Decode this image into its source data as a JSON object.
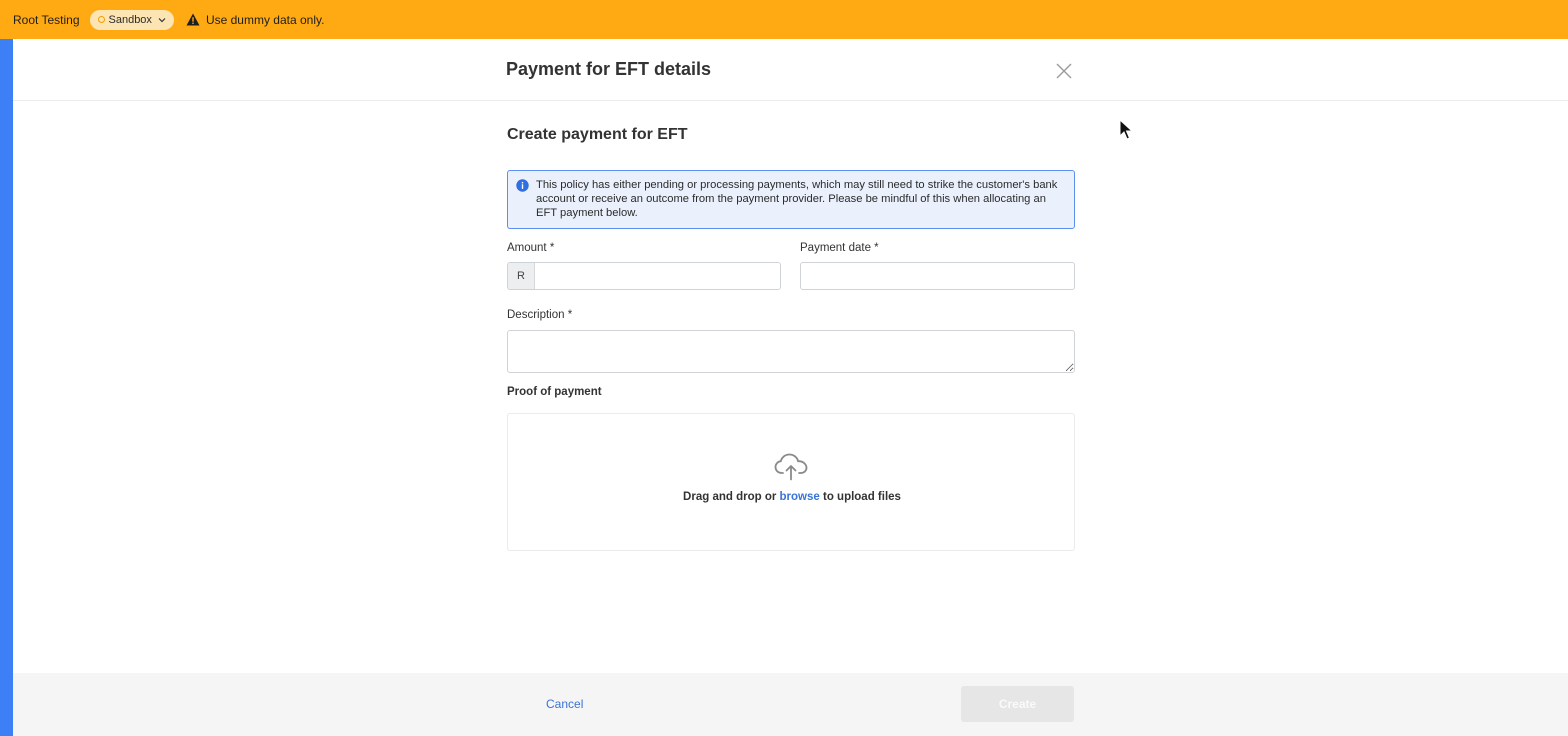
{
  "banner": {
    "org_name": "Root Testing",
    "environment": "Sandbox",
    "warning": "Use dummy data only.",
    "background_color": "#ffaa12"
  },
  "modal": {
    "title": "Payment for EFT details",
    "close_icon": "close-icon"
  },
  "form": {
    "section_title": "Create payment for EFT",
    "info_message": "This policy has either pending or processing payments, which may still need to strike the customer's bank account or receive an outcome from the payment provider. Please be mindful of this when allocating an EFT payment below.",
    "amount": {
      "label": "Amount *",
      "prefix": "R",
      "value": ""
    },
    "payment_date": {
      "label": "Payment date *",
      "value": ""
    },
    "description": {
      "label": "Description *",
      "value": ""
    },
    "proof_of_payment": {
      "label": "Proof of payment",
      "drop_text_before": "Drag and drop or ",
      "browse_link": "browse",
      "drop_text_after": " to upload files",
      "icon": "cloud-upload-icon"
    }
  },
  "footer": {
    "cancel_label": "Cancel",
    "create_label": "Create",
    "accent_color": "#3a74d8"
  }
}
